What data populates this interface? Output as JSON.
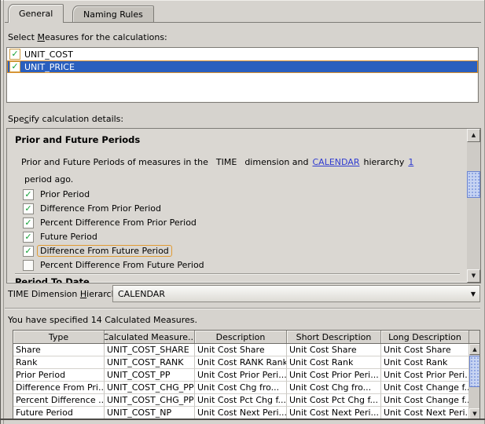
{
  "icons": {
    "check": "✓",
    "arrow_up": "▲",
    "arrow_down": "▼",
    "combo_arrow": "▼"
  },
  "colors": {
    "selection_blue": "#2a5fbe",
    "focus_orange": "#e09b33",
    "check_green": "#12a036",
    "link_blue": "#2f3bd0",
    "background": "#d6d3ce"
  },
  "tabs": [
    {
      "label": "General",
      "active": true
    },
    {
      "label": "Naming Rules",
      "active": false
    }
  ],
  "measures_section": {
    "label_prefix": "Select ",
    "label_mnemonic": "M",
    "label_suffix": "easures for the calculations:",
    "items": [
      {
        "name": "UNIT_COST",
        "checked": true,
        "selected": false
      },
      {
        "name": "UNIT_PRICE",
        "checked": true,
        "selected": true
      }
    ]
  },
  "details_section": {
    "label_prefix": "Spe",
    "label_mnemonic": "c",
    "label_suffix": "ify calculation details:",
    "panel_title": "Prior and Future Periods",
    "intro": {
      "part1": "Prior and Future Periods of measures in the",
      "dimension": "TIME",
      "part2": "dimension and",
      "hierarchy_link": "CALENDAR",
      "part3": "hierarchy",
      "periods_link": "1",
      "part4": "period ago."
    },
    "options": [
      {
        "label": "Prior Period",
        "checked": true,
        "focused": false
      },
      {
        "label": "Difference From Prior Period",
        "checked": true,
        "focused": false
      },
      {
        "label": "Percent Difference From Prior Period",
        "checked": true,
        "focused": false
      },
      {
        "label": "Future Period",
        "checked": true,
        "focused": false
      },
      {
        "label": "Difference From Future Period",
        "checked": true,
        "focused": true
      },
      {
        "label": "Percent Difference From Future Period",
        "checked": false,
        "focused": false
      }
    ],
    "next_panel_title": "Period To Date"
  },
  "hierarchy_row": {
    "label_prefix": "TIME Dimension ",
    "label_mnemonic": "H",
    "label_suffix": "ierarchy:",
    "value": "CALENDAR"
  },
  "summary_text": "You have specified 14 Calculated Measures.",
  "table": {
    "columns": [
      "Type",
      "Calculated Measure...",
      "Description",
      "Short Description",
      "Long Description"
    ],
    "rows": [
      [
        "Share",
        "UNIT_COST_SHARE",
        "Unit Cost Share",
        "Unit Cost Share",
        "Unit Cost Share"
      ],
      [
        "Rank",
        "UNIT_COST_RANK",
        "Unit Cost RANK Rank",
        "Unit Cost Rank",
        "Unit Cost Rank"
      ],
      [
        "Prior Period",
        "UNIT_COST_PP",
        "Unit Cost Prior Peri...",
        "Unit Cost Prior Peri...",
        "Unit Cost Prior Peri..."
      ],
      [
        "Difference From Pri...",
        "UNIT_COST_CHG_PP",
        "Unit Cost Chg fro...",
        "Unit Cost Chg fro...",
        "Unit Cost Change f..."
      ],
      [
        "Percent Difference ...",
        "UNIT_COST_CHG_PP",
        "Unit Cost Pct Chg f...",
        "Unit Cost Pct Chg f...",
        "Unit Cost Change f..."
      ],
      [
        "Future Period",
        "UNIT_COST_NP",
        "Unit Cost Next Peri...",
        "Unit Cost Next Peri...",
        "Unit Cost Next Peri..."
      ]
    ]
  }
}
